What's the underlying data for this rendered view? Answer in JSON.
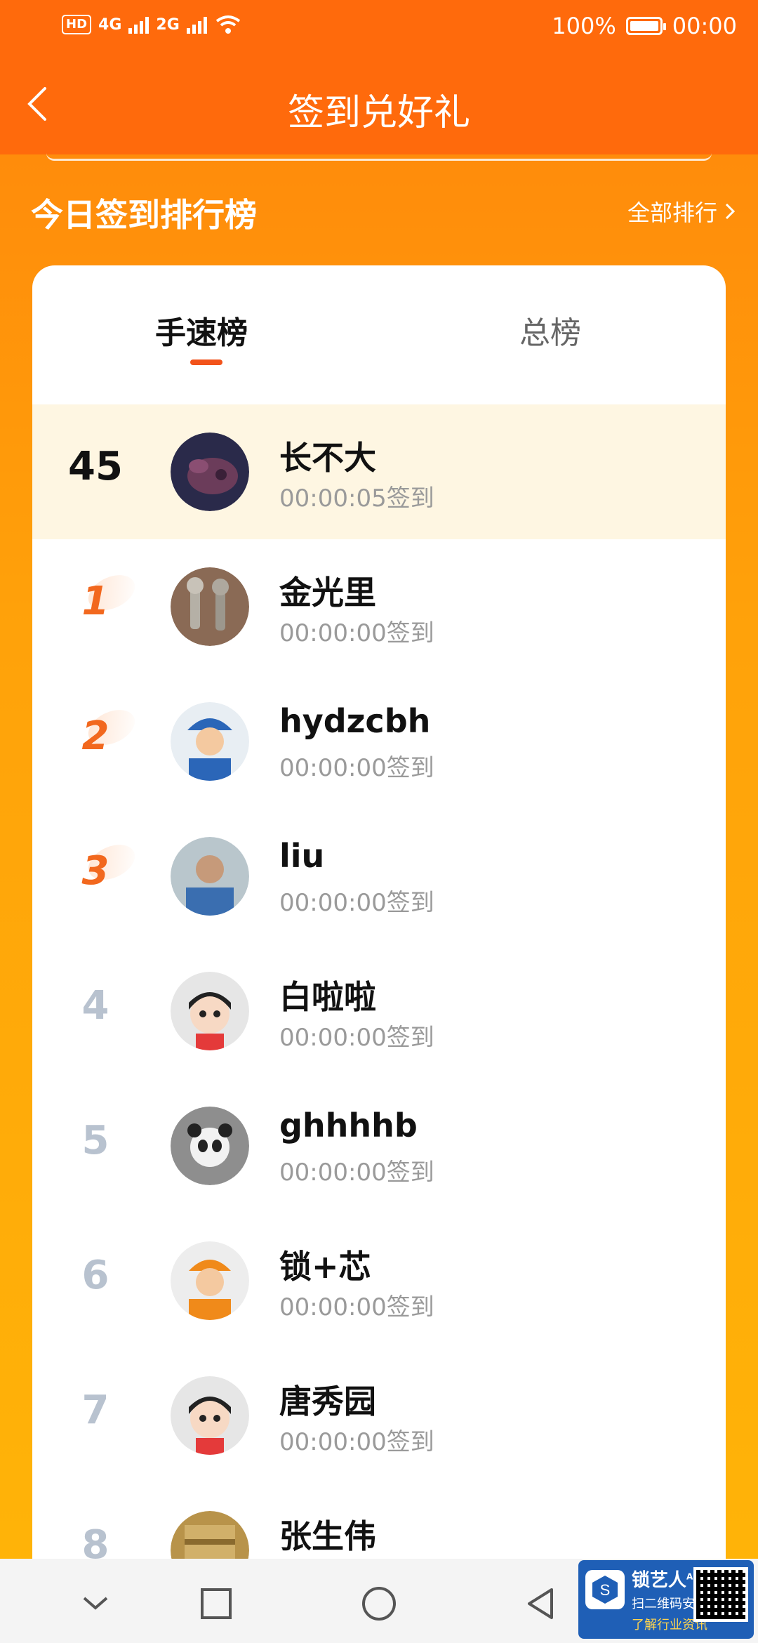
{
  "status_bar": {
    "network_label": "HD",
    "sim1": "4G",
    "sim2": "2G",
    "battery_text": "100%",
    "time": "00:00"
  },
  "header": {
    "title": "签到兑好礼",
    "back_icon": "chevron-left-icon"
  },
  "section": {
    "title": "今日签到排行榜",
    "all_rank_label": "全部排行"
  },
  "tabs": [
    {
      "label": "手速榜",
      "active": true
    },
    {
      "label": "总榜",
      "active": false
    }
  ],
  "rows": [
    {
      "rank": "45",
      "name": "长不大",
      "time": "00:00:05签到",
      "highlight": true
    },
    {
      "rank": "1",
      "name": "金光里",
      "time": "00:00:00签到"
    },
    {
      "rank": "2",
      "name": "hydzcbh",
      "time": "00:00:00签到"
    },
    {
      "rank": "3",
      "name": "liu",
      "time": "00:00:00签到"
    },
    {
      "rank": "4",
      "name": "白啦啦",
      "time": "00:00:00签到"
    },
    {
      "rank": "5",
      "name": "ghhhhb",
      "time": "00:00:00签到"
    },
    {
      "rank": "6",
      "name": "锁+芯",
      "time": "00:00:00签到"
    },
    {
      "rank": "7",
      "name": "唐秀园",
      "time": "00:00:00签到"
    },
    {
      "rank": "8",
      "name": "张生伟",
      "time": ""
    }
  ],
  "colors": {
    "header": "#FF6A0C",
    "accent": "#F2531B",
    "highlight_row": "#FEF6E2",
    "top_rank": "#F2681E",
    "plain_rank": "#B8C2CF"
  },
  "watermark": {
    "name": "锁艺人",
    "sup": "APP",
    "line1": "扫二维码安装",
    "line2": "了解行业资讯"
  }
}
